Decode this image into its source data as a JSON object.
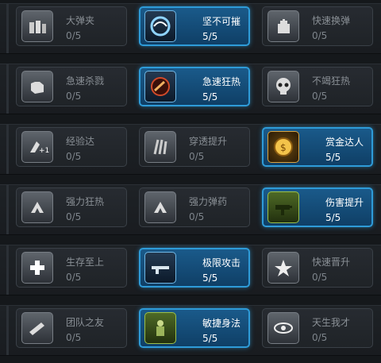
{
  "skills": [
    [
      {
        "name": "大弹夹",
        "level": "0/5",
        "icon": "ammo-clip-icon",
        "state": "locked"
      },
      {
        "name": "坚不可摧",
        "level": "5/5",
        "icon": "shield-swirl-icon",
        "state": "active"
      },
      {
        "name": "快速换弹",
        "level": "0/5",
        "icon": "hand-reload-icon",
        "state": "locked"
      }
    ],
    [
      {
        "name": "急速杀戮",
        "level": "0/5",
        "icon": "fist-icon",
        "state": "locked"
      },
      {
        "name": "急速狂热",
        "level": "5/5",
        "icon": "bullets-icon",
        "state": "active"
      },
      {
        "name": "不竭狂热",
        "level": "0/5",
        "icon": "skull-icon",
        "state": "locked"
      }
    ],
    [
      {
        "name": "经验达",
        "level": "0/5",
        "icon": "xp-plus-icon",
        "state": "locked"
      },
      {
        "name": "穿透提升",
        "level": "0/5",
        "icon": "claw-icon",
        "state": "locked"
      },
      {
        "name": "赏金达人",
        "level": "5/5",
        "icon": "gold-coin-icon",
        "state": "active-gold"
      }
    ],
    [
      {
        "name": "强力狂热",
        "level": "0/5",
        "icon": "arrow-up-icon",
        "state": "locked"
      },
      {
        "name": "强力弹药",
        "level": "0/5",
        "icon": "arrow-up-icon",
        "state": "locked"
      },
      {
        "name": "伤害提升",
        "level": "5/5",
        "icon": "gun-icon",
        "state": "active-green"
      }
    ],
    [
      {
        "name": "生存至上",
        "level": "0/5",
        "icon": "medical-cross-icon",
        "state": "locked"
      },
      {
        "name": "极限攻击",
        "level": "5/5",
        "icon": "rifle-icon",
        "state": "active"
      },
      {
        "name": "快速晋升",
        "level": "0/5",
        "icon": "rank-star-icon",
        "state": "locked"
      }
    ],
    [
      {
        "name": "团队之友",
        "level": "0/5",
        "icon": "team-gun-icon",
        "state": "locked"
      },
      {
        "name": "敏捷身法",
        "level": "5/5",
        "icon": "soldier-icon",
        "state": "active-green"
      },
      {
        "name": "天生我才",
        "level": "0/5",
        "icon": "eye-icon",
        "state": "locked"
      }
    ]
  ]
}
